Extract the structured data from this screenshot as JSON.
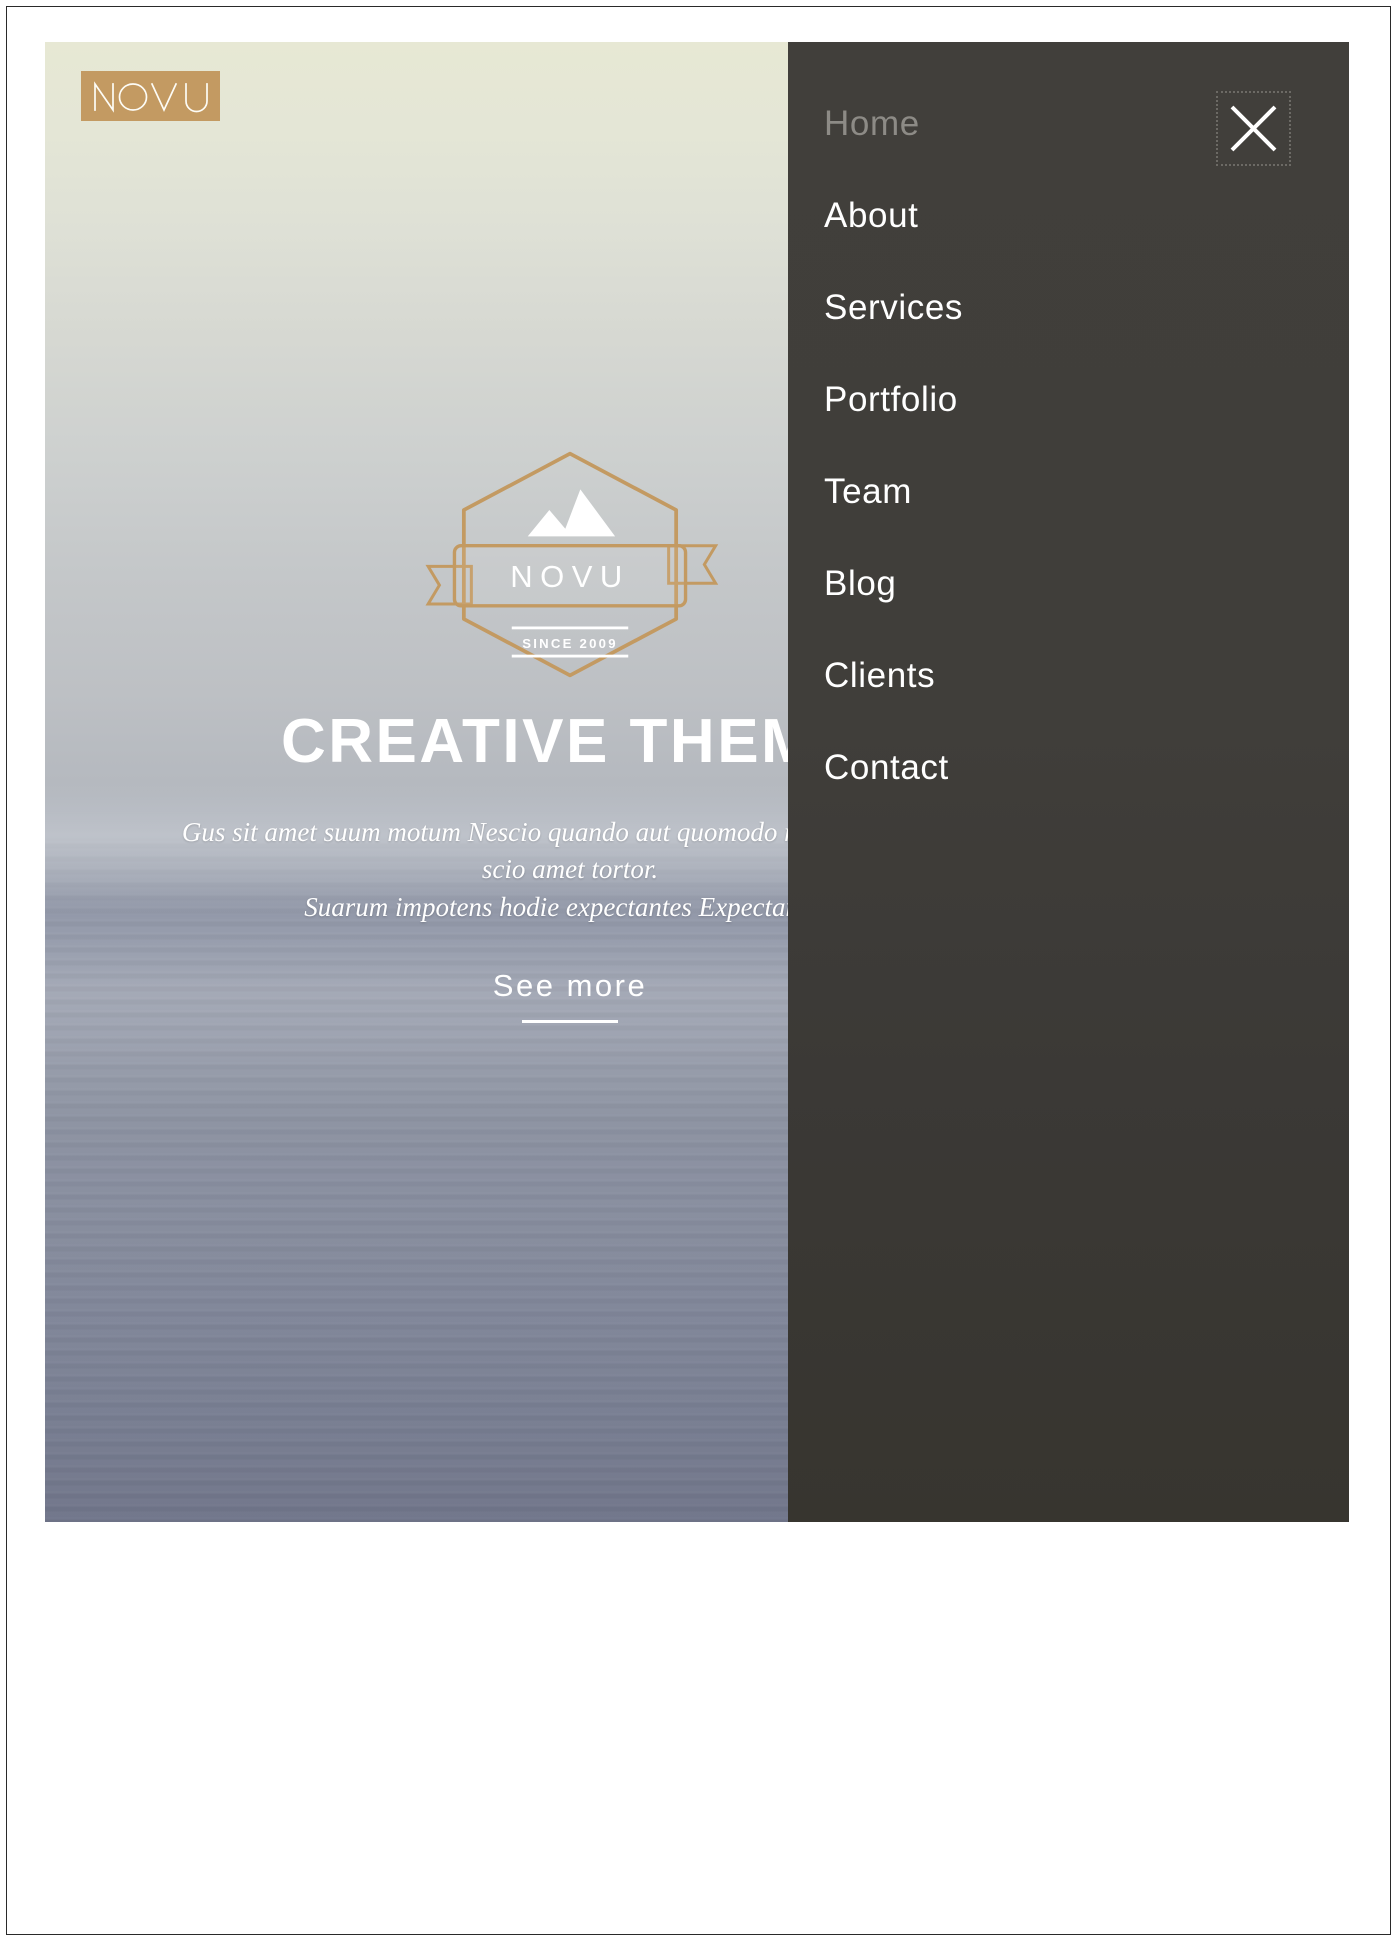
{
  "brand": {
    "logo_text": "NOVU",
    "logo_bg_color": "#c39a62"
  },
  "hero": {
    "crest": {
      "name": "NOVU",
      "since": "SINCE 2009",
      "icon": "mountain-icon",
      "outline_color": "#c39a62"
    },
    "title": "CREATIVE THEME",
    "subtitle_lines": [
      "Gus sit amet suum motum Nescio quando aut quomodo nescio quo Illud",
      "scio amet tortor.",
      "Suarum impotens hodie expectantes Expectantes."
    ],
    "cta_label": "See more"
  },
  "nav": {
    "panel_bg_color": "#403e3a",
    "close_label": "close-icon",
    "items": [
      {
        "label": "Home",
        "active": true
      },
      {
        "label": "About",
        "active": false
      },
      {
        "label": "Services",
        "active": false
      },
      {
        "label": "Portfolio",
        "active": false
      },
      {
        "label": "Team",
        "active": false
      },
      {
        "label": "Blog",
        "active": false
      },
      {
        "label": "Clients",
        "active": false
      },
      {
        "label": "Contact",
        "active": false
      }
    ]
  }
}
